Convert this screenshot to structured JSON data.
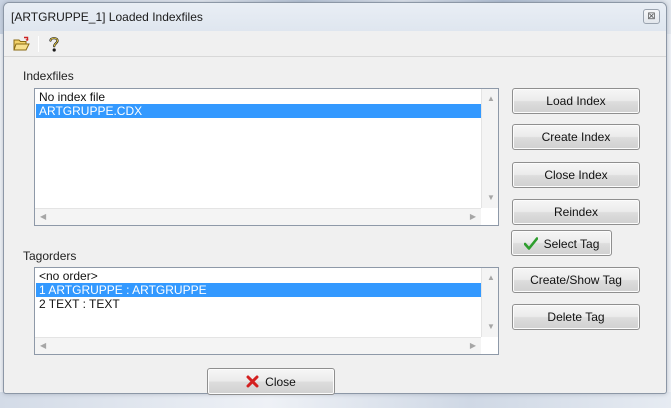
{
  "window": {
    "title": "[ARTGRUPPE_1] Loaded Indexfiles",
    "close_glyph": "⊠"
  },
  "toolbar": {
    "icons": [
      "open-folder-icon",
      "help-icon"
    ]
  },
  "indexfiles": {
    "label": "Indexfiles",
    "items": [
      {
        "text": "No index file",
        "selected": false
      },
      {
        "text": "ARTGRUPPE.CDX",
        "selected": true
      }
    ]
  },
  "tagorders": {
    "label": "Tagorders",
    "items": [
      {
        "text": "<no order>",
        "selected": false
      },
      {
        "text": "1 ARTGRUPPE : ARTGRUPPE",
        "selected": true
      },
      {
        "text": "2 TEXT : TEXT",
        "selected": false
      }
    ]
  },
  "buttons": {
    "load_index": "Load Index",
    "create_index": "Create Index",
    "close_index": "Close Index",
    "reindex": "Reindex",
    "select_tag": "Select Tag",
    "create_show_tag": "Create/Show Tag",
    "delete_tag": "Delete Tag",
    "close": "Close"
  },
  "colors": {
    "selection": "#3399ff",
    "check_green": "#2e9e2e",
    "close_red": "#d42020"
  }
}
